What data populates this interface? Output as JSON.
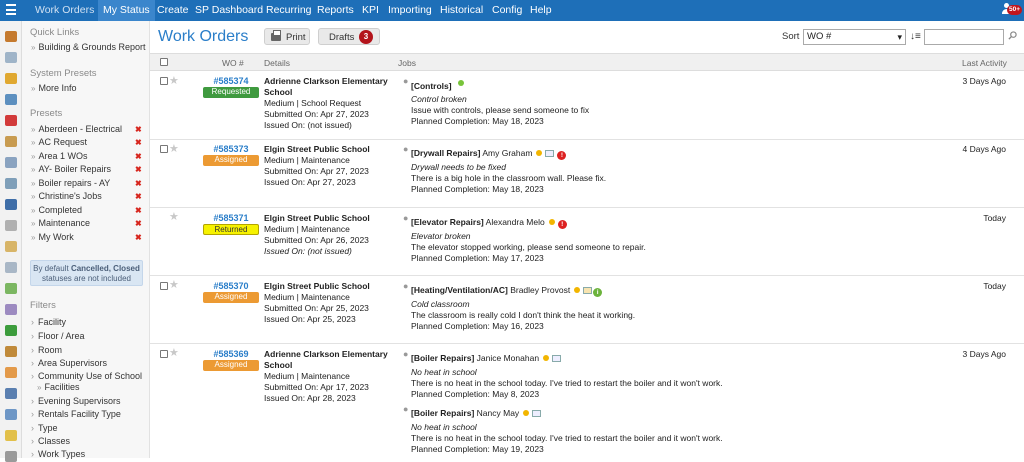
{
  "nav": {
    "items": [
      "Work Orders",
      "My Status",
      "Create",
      "SP Dashboard",
      "Recurring",
      "Reports",
      "KPI",
      "Importing",
      "Historical",
      "Config",
      "Help"
    ],
    "notification_count": "50+"
  },
  "sidebar": {
    "quick_links_label": "Quick Links",
    "quick_links": [
      "Building & Grounds Report"
    ],
    "system_presets_label": "System Presets",
    "system_presets": [
      "More Info"
    ],
    "presets_label": "Presets",
    "presets": [
      "Aberdeen - Electrical",
      "AC Request",
      "Area 1 WOs",
      "AY- Boiler Repairs",
      "Boiler repairs - AY",
      "Christine's Jobs",
      "Completed",
      "Maintenance",
      "My Work"
    ],
    "remove_mark": "✖",
    "info_text_pre": "By default ",
    "info_text_bold": "Cancelled, Closed",
    "info_text_post": "statuses are not included",
    "filters_label": "Filters",
    "filters": [
      "Facility",
      "Floor / Area",
      "Room",
      "Area Supervisors",
      "Community Use of School",
      "Facilities",
      "Evening Supervisors",
      "Rentals Facility Type",
      "Type",
      "Classes",
      "Work Types"
    ]
  },
  "header": {
    "title": "Work Orders",
    "print_label": "Print",
    "drafts_label": "Drafts",
    "drafts_count": "3",
    "sort_label": "Sort",
    "sort_value": "WO #"
  },
  "table": {
    "columns": [
      "WO #",
      "Details",
      "Jobs",
      "Last Activity"
    ],
    "rows": [
      {
        "wo": "#585374",
        "status": "Requested",
        "details": [
          "Adrienne Clarkson Elementary",
          "School",
          "Medium | School Request",
          "Submitted On: Apr 27, 2023",
          "Issued On: (not issued)"
        ],
        "jobs": [
          {
            "title": "[Controls]",
            "person": "",
            "desc": "Control broken",
            "text": "Issue with controls, please send someone to fix",
            "planned": "Planned Completion: May 18, 2023"
          }
        ],
        "last_activity": "3 Days Ago"
      },
      {
        "wo": "#585373",
        "status": "Assigned",
        "details": [
          "Elgin Street Public School",
          "Medium | Maintenance",
          "Submitted On: Apr 27, 2023",
          "Issued On: Apr 27, 2023"
        ],
        "jobs": [
          {
            "title": "[Drywall Repairs]",
            "person": "Amy Graham",
            "desc": "Drywall needs to be fixed",
            "text": "There is a big hole in the classroom wall. Please fix.",
            "planned": "Planned Completion: May 18, 2023"
          }
        ],
        "last_activity": "4 Days Ago"
      },
      {
        "wo": "#585371",
        "status": "Returned",
        "details": [
          "Elgin Street Public School",
          "Medium | Maintenance",
          "Submitted On: Apr 26, 2023",
          "Issued On: (not issued)"
        ],
        "jobs": [
          {
            "title": "[Elevator Repairs]",
            "person": "Alexandra Melo",
            "desc": "Elevator broken",
            "text": "The elevator stopped working, please send someone to repair.",
            "planned": "Planned Completion: May 17, 2023"
          }
        ],
        "last_activity": "Today"
      },
      {
        "wo": "#585370",
        "status": "Assigned",
        "details": [
          "Elgin Street Public School",
          "Medium | Maintenance",
          "Submitted On: Apr 25, 2023",
          "Issued On: Apr 25, 2023"
        ],
        "jobs": [
          {
            "title": "[Heating/Ventilation/AC]",
            "person": "Bradley Provost",
            "desc": "Cold classroom",
            "text": "The classroom is really cold I don't think the heat it working.",
            "planned": "Planned Completion: May 16, 2023"
          }
        ],
        "last_activity": "Today"
      },
      {
        "wo": "#585369",
        "status": "Assigned",
        "details": [
          "Adrienne Clarkson Elementary",
          "School",
          "Medium | Maintenance",
          "Submitted On: Apr 17, 2023",
          "Issued On: Apr 28, 2023"
        ],
        "jobs": [
          {
            "title": "[Boiler Repairs]",
            "person": "Janice Monahan",
            "desc": "No heat in school",
            "text": "There is no heat in the school today. I've tried to restart the boiler and it won't work.",
            "planned": "Planned Completion: May 8, 2023"
          },
          {
            "title": "[Boiler Repairs]",
            "person": "Nancy May",
            "desc": "No heat in school",
            "text": "There is no heat in the school today. I've tried to restart the boiler and it won't work.",
            "planned": "Planned Completion: May 19, 2023"
          }
        ],
        "last_activity": "3 Days Ago"
      }
    ]
  },
  "icons": {
    "alert": "!",
    "info": "i"
  }
}
